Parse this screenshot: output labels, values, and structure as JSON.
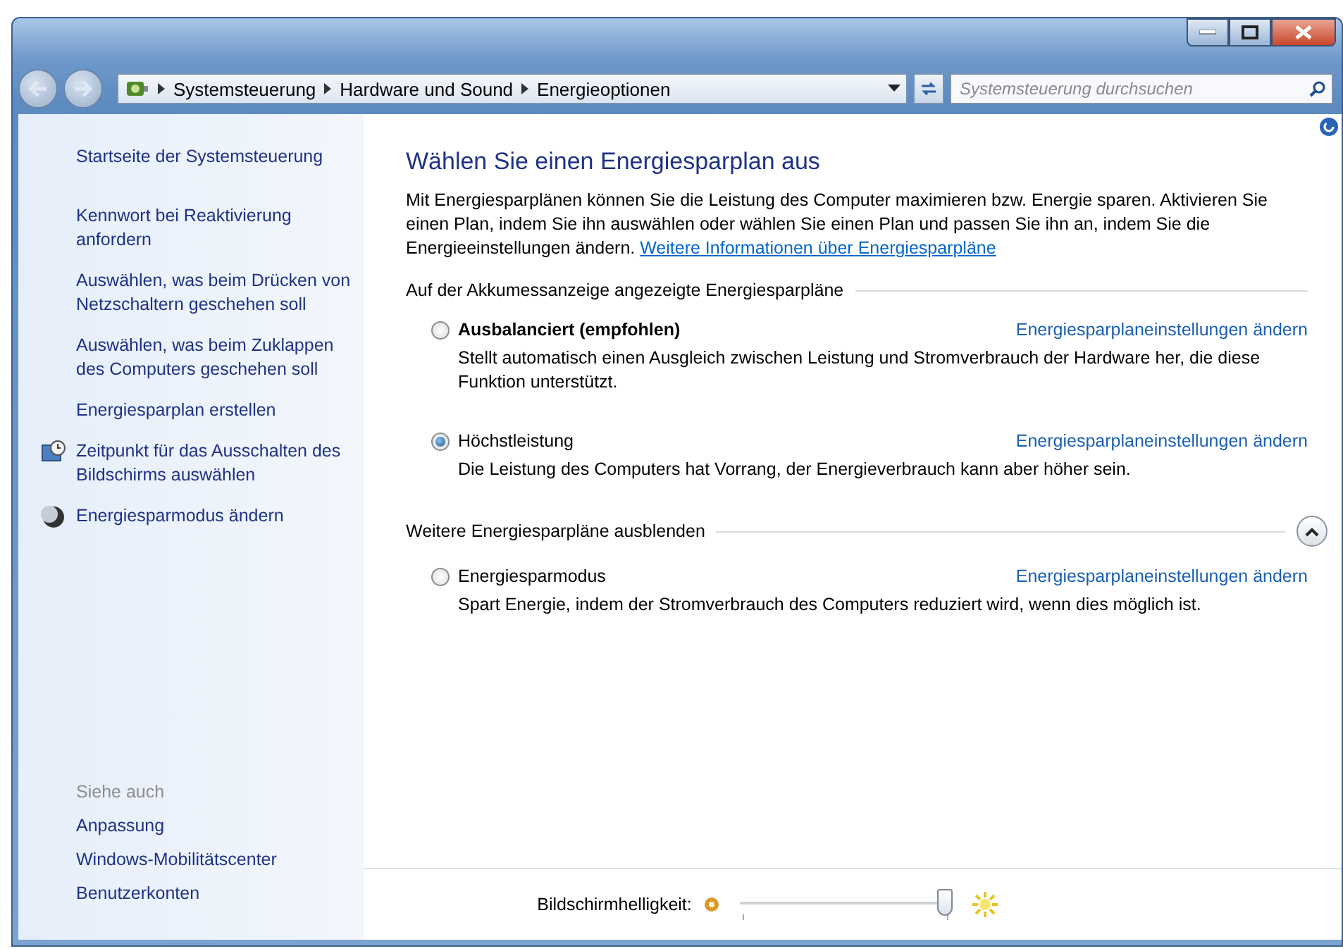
{
  "breadcrumb": [
    "Systemsteuerung",
    "Hardware und Sound",
    "Energieoptionen"
  ],
  "search": {
    "placeholder": "Systemsteuerung durchsuchen"
  },
  "sidebar": {
    "links": [
      "Startseite der Systemsteuerung",
      "Kennwort bei Reaktivierung anfordern",
      "Auswählen, was beim Drücken von Netzschaltern geschehen soll",
      "Auswählen, was beim Zuklappen des Computers geschehen soll",
      "Energiesparplan erstellen",
      "Zeitpunkt für das Ausschalten des Bildschirms auswählen",
      "Energiesparmodus ändern"
    ],
    "see_also_title": "Siehe auch",
    "see_also": [
      "Anpassung",
      "Windows-Mobilitätscenter",
      "Benutzerkonten"
    ]
  },
  "main": {
    "title": "Wählen Sie einen Energiesparplan aus",
    "intro": "Mit Energiesparplänen können Sie die Leistung des Computer maximieren bzw. Energie sparen. Aktivieren Sie einen Plan, indem Sie ihn auswählen oder wählen Sie einen Plan und passen Sie ihn an, indem Sie die Energieeinstellungen ändern.",
    "intro_link": "Weitere Informationen über Energiesparpläne",
    "groups": [
      {
        "heading": "Auf der Akkumessanzeige angezeigte Energiesparpläne",
        "kind": "plain",
        "plans": [
          {
            "name": "Ausbalanciert (empfohlen)",
            "emphasized": true,
            "selected": false,
            "link": "Energiesparplaneinstellungen ändern",
            "description": "Stellt automatisch einen Ausgleich zwischen Leistung und Stromverbrauch der Hardware her, die diese Funktion unterstützt."
          },
          {
            "name": "Höchstleistung",
            "emphasized": false,
            "selected": true,
            "link": "Energiesparplaneinstellungen ändern",
            "description": "Die Leistung des Computers hat Vorrang, der Energieverbrauch kann aber höher sein."
          }
        ]
      },
      {
        "heading": "Weitere Energiesparpläne ausblenden",
        "kind": "collapsible",
        "expanded": true,
        "plans": [
          {
            "name": "Energiesparmodus",
            "emphasized": false,
            "selected": false,
            "link": "Energiesparplaneinstellungen ändern",
            "description": "Spart Energie, indem der Stromverbrauch des Computers reduziert wird, wenn dies möglich ist."
          }
        ]
      }
    ]
  },
  "brightness": {
    "label": "Bildschirmhelligkeit:",
    "level": 0.97
  }
}
